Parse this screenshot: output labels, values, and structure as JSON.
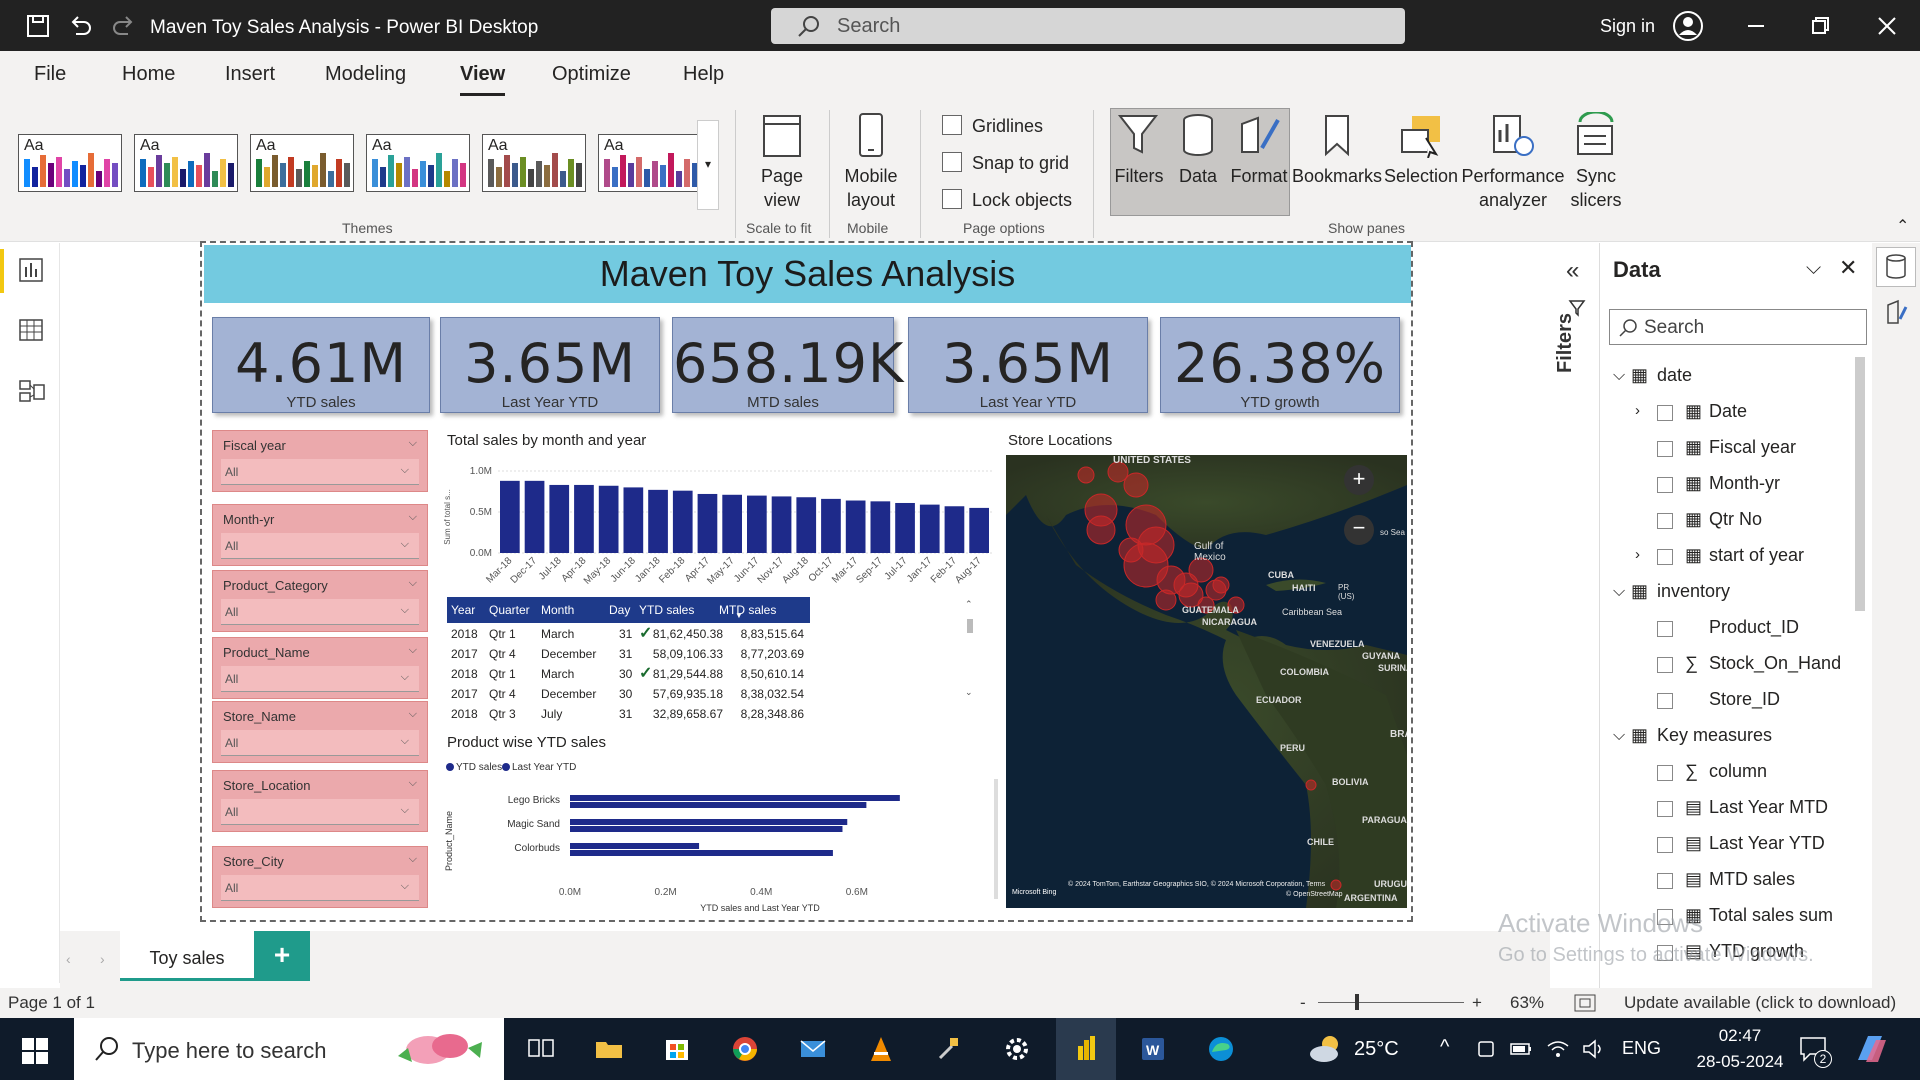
{
  "titlebar": {
    "title": "Maven Toy Sales Analysis - Power BI Desktop",
    "search_placeholder": "Search",
    "sign_in": "Sign in"
  },
  "menu": {
    "items": [
      "File",
      "Home",
      "Insert",
      "Modeling",
      "View",
      "Optimize",
      "Help"
    ],
    "active": "View"
  },
  "ribbon": {
    "themes_label": "Themes",
    "page_view": "Page view",
    "scale_to_fit": "Scale to fit",
    "mobile_layout": "Mobile layout",
    "mobile": "Mobile",
    "gridlines": "Gridlines",
    "snap_to_grid": "Snap to grid",
    "lock_objects": "Lock objects",
    "page_options": "Page options",
    "filters": "Filters",
    "data": "Data",
    "format": "Format",
    "bookmarks": "Bookmarks",
    "selection": "Selection",
    "performance_analyzer": "Performance analyzer",
    "sync_slicers": "Sync slicers",
    "show_panes": "Show panes",
    "theme_aa": "Aa"
  },
  "report": {
    "title": "Maven Toy Sales Analysis",
    "kpis": [
      {
        "value": "4.61M",
        "label": "YTD sales"
      },
      {
        "value": "3.65M",
        "label": "Last Year YTD"
      },
      {
        "value": "658.19K",
        "label": "MTD sales"
      },
      {
        "value": "3.65M",
        "label": "Last Year YTD"
      },
      {
        "value": "26.38%",
        "label": "YTD growth"
      }
    ],
    "slicers": [
      {
        "label": "Fiscal year",
        "value": "All"
      },
      {
        "label": "Month-yr",
        "value": "All"
      },
      {
        "label": "Product_Category",
        "value": "All"
      },
      {
        "label": "Product_Name",
        "value": "All"
      },
      {
        "label": "Store_Name",
        "value": "All"
      },
      {
        "label": "Store_Location",
        "value": "All"
      },
      {
        "label": "Store_City",
        "value": "All"
      }
    ],
    "map_title": "Store Locations",
    "map_labels": [
      "UNITED STATES",
      "Gulf of Mexico",
      "CUBA",
      "HAITI",
      "PR (US)",
      "GUATEMALA",
      "NICARAGUA",
      "Caribbean Sea",
      "VENEZUELA",
      "GUYANA",
      "SURINA",
      "COLOMBIA",
      "ECUADOR",
      "PERU",
      "BRA",
      "BOLIVIA",
      "PARAGUA",
      "CHILE",
      "URUGU",
      "ARGENTINA",
      "so Sea"
    ],
    "map_credit": "Microsoft Bing",
    "map_copyright": "© 2024 TomTom, Earthstar Geographics SIO, © 2024 Microsoft Corporation, Terms",
    "map_osm": "© OpenStreetMap",
    "table": {
      "headers": [
        "Year",
        "Quarter",
        "Month",
        "Day",
        "YTD sales",
        "MTD sales"
      ],
      "rows": [
        [
          "2018",
          "Qtr 1",
          "March",
          "31",
          "81,62,450.38",
          "8,83,515.64"
        ],
        [
          "2017",
          "Qtr 4",
          "December",
          "31",
          "58,09,106.33",
          "8,77,203.69"
        ],
        [
          "2018",
          "Qtr 1",
          "March",
          "30",
          "81,29,544.88",
          "8,50,610.14"
        ],
        [
          "2017",
          "Qtr 4",
          "December",
          "30",
          "57,69,935.18",
          "8,38,032.54"
        ],
        [
          "2018",
          "Qtr 3",
          "July",
          "31",
          "32,89,658.67",
          "8,28,348.86"
        ]
      ],
      "checked_rows": [
        0,
        2
      ]
    }
  },
  "chart_data": [
    {
      "type": "bar",
      "title": "Total sales by month and year",
      "ylabel": "Sum of total s...",
      "xlabel": "",
      "ylim": [
        0,
        1.0
      ],
      "yticks": [
        "1.0M",
        "0.5M",
        "0.0M"
      ],
      "yticks_values": [
        1.0,
        0.5,
        0.0
      ],
      "categories": [
        "Mar-18",
        "Dec-17",
        "Jul-18",
        "Apr-18",
        "May-18",
        "Jun-18",
        "Jan-18",
        "Feb-18",
        "Apr-17",
        "May-17",
        "Jun-17",
        "Nov-17",
        "Aug-18",
        "Oct-17",
        "Mar-17",
        "Sep-17",
        "Jul-17",
        "Jan-17",
        "Feb-17",
        "Aug-17"
      ],
      "values": [
        0.88,
        0.88,
        0.83,
        0.83,
        0.82,
        0.8,
        0.77,
        0.76,
        0.72,
        0.71,
        0.7,
        0.69,
        0.68,
        0.66,
        0.64,
        0.63,
        0.61,
        0.59,
        0.57,
        0.55
      ],
      "color": "#1e2a8a"
    },
    {
      "type": "bar",
      "orientation": "horizontal",
      "title": "Product wise YTD sales",
      "legend": [
        "YTD sales",
        "Last Year YTD"
      ],
      "legend_position": "top-left",
      "xlabel": "YTD sales and Last Year YTD",
      "ylabel": "Product_Name",
      "xlim": [
        0,
        0.7
      ],
      "xticks": [
        "0.0M",
        "0.2M",
        "0.4M",
        "0.6M"
      ],
      "xticks_values": [
        0,
        0.2,
        0.4,
        0.6
      ],
      "categories": [
        "Lego Bricks",
        "Magic Sand",
        "Colorbuds"
      ],
      "series": [
        {
          "name": "YTD sales",
          "values": [
            0.69,
            0.58,
            0.27
          ],
          "color": "#1e2a8a"
        },
        {
          "name": "Last Year YTD",
          "values": [
            0.62,
            0.57,
            0.55
          ],
          "color": "#1e2a8a"
        }
      ]
    }
  ],
  "pages": {
    "tabs": [
      "Toy sales"
    ],
    "add_label": "+"
  },
  "status": {
    "page": "Page 1 of 1",
    "zoom": "63%",
    "update": "Update available (click to download)"
  },
  "panes": {
    "filters_label": "Filters",
    "data_title": "Data",
    "search_placeholder": "Search",
    "tree": [
      {
        "label": "date",
        "level": 0,
        "kind": "table"
      },
      {
        "label": "Date",
        "level": 1,
        "kind": "date"
      },
      {
        "label": "Fiscal year",
        "level": 1,
        "kind": "hier"
      },
      {
        "label": "Month-yr",
        "level": 1,
        "kind": "fx"
      },
      {
        "label": "Qtr No",
        "level": 1,
        "kind": "hier"
      },
      {
        "label": "start of year",
        "level": 1,
        "kind": "fx"
      },
      {
        "label": "inventory",
        "level": 0,
        "kind": "table"
      },
      {
        "label": "Product_ID",
        "level": 1,
        "kind": "field"
      },
      {
        "label": "Stock_On_Hand",
        "level": 1,
        "kind": "sum"
      },
      {
        "label": "Store_ID",
        "level": 1,
        "kind": "field"
      },
      {
        "label": "Key measures",
        "level": 0,
        "kind": "table"
      },
      {
        "label": "column",
        "level": 1,
        "kind": "sum"
      },
      {
        "label": "Last Year MTD",
        "level": 1,
        "kind": "calc"
      },
      {
        "label": "Last Year YTD",
        "level": 1,
        "kind": "calc"
      },
      {
        "label": "MTD sales",
        "level": 1,
        "kind": "calc"
      },
      {
        "label": "Total sales sum",
        "level": 1,
        "kind": "hier"
      },
      {
        "label": "YTD growth",
        "level": 1,
        "kind": "calc"
      }
    ]
  },
  "watermark": {
    "line1": "Activate Windows",
    "line2": "Go to Settings to activate Windows."
  },
  "taskbar": {
    "search_placeholder": "Type here to search",
    "weather": "25°C",
    "lang": "ENG",
    "time": "02:47",
    "date": "28-05-2024",
    "notif": "2"
  }
}
